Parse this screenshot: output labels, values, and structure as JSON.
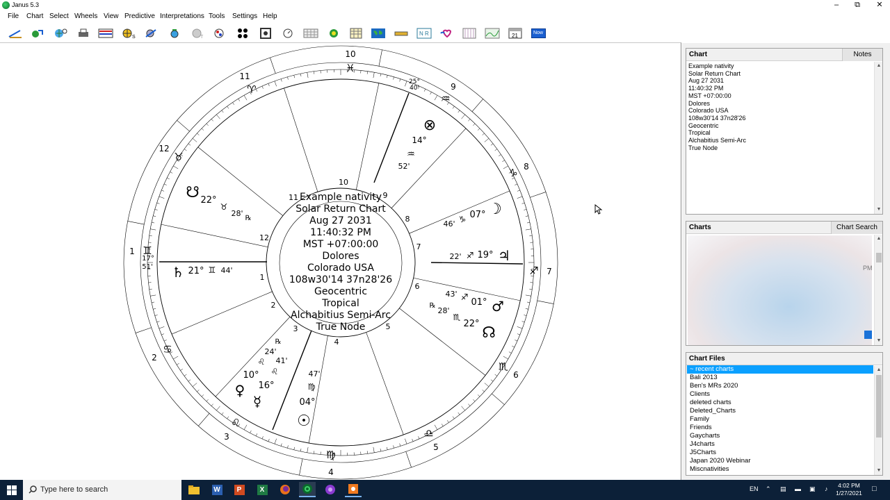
{
  "window": {
    "title": "Janus 5.3"
  },
  "menu": [
    "File",
    "Chart",
    "Select",
    "Wheels",
    "View",
    "Predictive",
    "Interpretations",
    "Tools",
    "Settings",
    "Help"
  ],
  "toolbar": {
    "now_label": "Now",
    "nr_label": "N R",
    "cal_label": "21"
  },
  "chart_panel": {
    "title": "Chart",
    "notes_label": "Notes",
    "lines": [
      "Example nativity",
      "Solar Return Chart",
      "Aug 27 2031",
      "11:40:32 PM",
      "MST +07:00:00",
      "Dolores",
      "Colorado USA",
      "108w30'14 37n28'26",
      "Geocentric",
      "Tropical",
      "Alchabitius Semi-Arc",
      "True Node"
    ]
  },
  "charts_panel": {
    "title": "Charts",
    "search_label": "Chart Search",
    "pm_fragment": "PM"
  },
  "files_panel": {
    "title": "Chart Files",
    "items": [
      "~ recent charts",
      "Bali 2013",
      "Ben's MRs 2020",
      "Clients",
      "deleted charts",
      "Deleted_Charts",
      "Family",
      "Friends",
      "Gaycharts",
      "J4charts",
      "J5Charts",
      "Japan 2020 Webinar",
      "Miscnativities"
    ]
  },
  "wheel": {
    "center_lines": [
      "Example nativity",
      "Solar Return Chart",
      "Aug 27 2031",
      "11:40:32 PM",
      "MST +07:00:00",
      "Dolores",
      "Colorado USA",
      "108w30'14 37n28'26",
      "Geocentric",
      "Tropical",
      "Alchabitius Semi-Arc",
      "True Node"
    ],
    "outer_house_numbers": [
      "10",
      "9",
      "8",
      "7",
      "6",
      "5",
      "4",
      "3",
      "2",
      "1",
      "12",
      "11"
    ],
    "inner_house_numbers": [
      "10",
      "9",
      "8",
      "7",
      "6",
      "5",
      "4",
      "3",
      "2",
      "1",
      "12",
      "11"
    ],
    "cusp_labels": {
      "c9_deg": "25°",
      "c9_min": "40'",
      "c1_deg": "17°",
      "c1_min": "51'"
    },
    "planets": {
      "pof": {
        "glyph": "⊗",
        "deg": "14°",
        "sign": "♒",
        "min": "52'"
      },
      "moon": {
        "glyph": "☽",
        "deg": "07°",
        "sign": "♑",
        "min": "46'"
      },
      "jupiter": {
        "glyph": "♃",
        "deg": "19°",
        "sign": "♐",
        "min": "22'"
      },
      "mars": {
        "glyph": "♂",
        "deg": "01°",
        "sign": "♐",
        "min": "43'"
      },
      "node": {
        "glyph": "☊",
        "deg": "22°",
        "sign": "♏",
        "min": "28'",
        "retro": "℞"
      },
      "sun": {
        "glyph": "☉",
        "deg": "04°",
        "sign": "♍",
        "min": "47'"
      },
      "mercury": {
        "glyph": "☿",
        "deg": "16°",
        "sign": "♌",
        "min": "41'",
        "retro": "℞"
      },
      "venus": {
        "glyph": "♀",
        "deg": "10°",
        "sign": "♌",
        "min": "24'"
      },
      "saturn": {
        "glyph": "♄",
        "deg": "21°",
        "sign": "♊",
        "min": "44'"
      },
      "southnode": {
        "glyph": "☋",
        "deg": "22°",
        "sign": "♉",
        "min": "28'",
        "retro": "℞"
      }
    },
    "signs": {
      "pisces": "♓",
      "aquarius": "♒",
      "capricorn": "♑",
      "sagittarius": "♐",
      "scorpio": "♏",
      "libra": "♎",
      "virgo": "♍",
      "leo": "♌",
      "cancer": "♋",
      "gemini": "♊",
      "taurus": "♉",
      "aries": "♈"
    }
  },
  "taskbar": {
    "search_placeholder": "Type here to search",
    "lang": "EN",
    "time": "4:02 PM",
    "date": "1/27/2021"
  },
  "colors": {
    "selection": "#0ba0ff",
    "taskbar": "#0c2038",
    "now_button": "#1a5fd0"
  }
}
